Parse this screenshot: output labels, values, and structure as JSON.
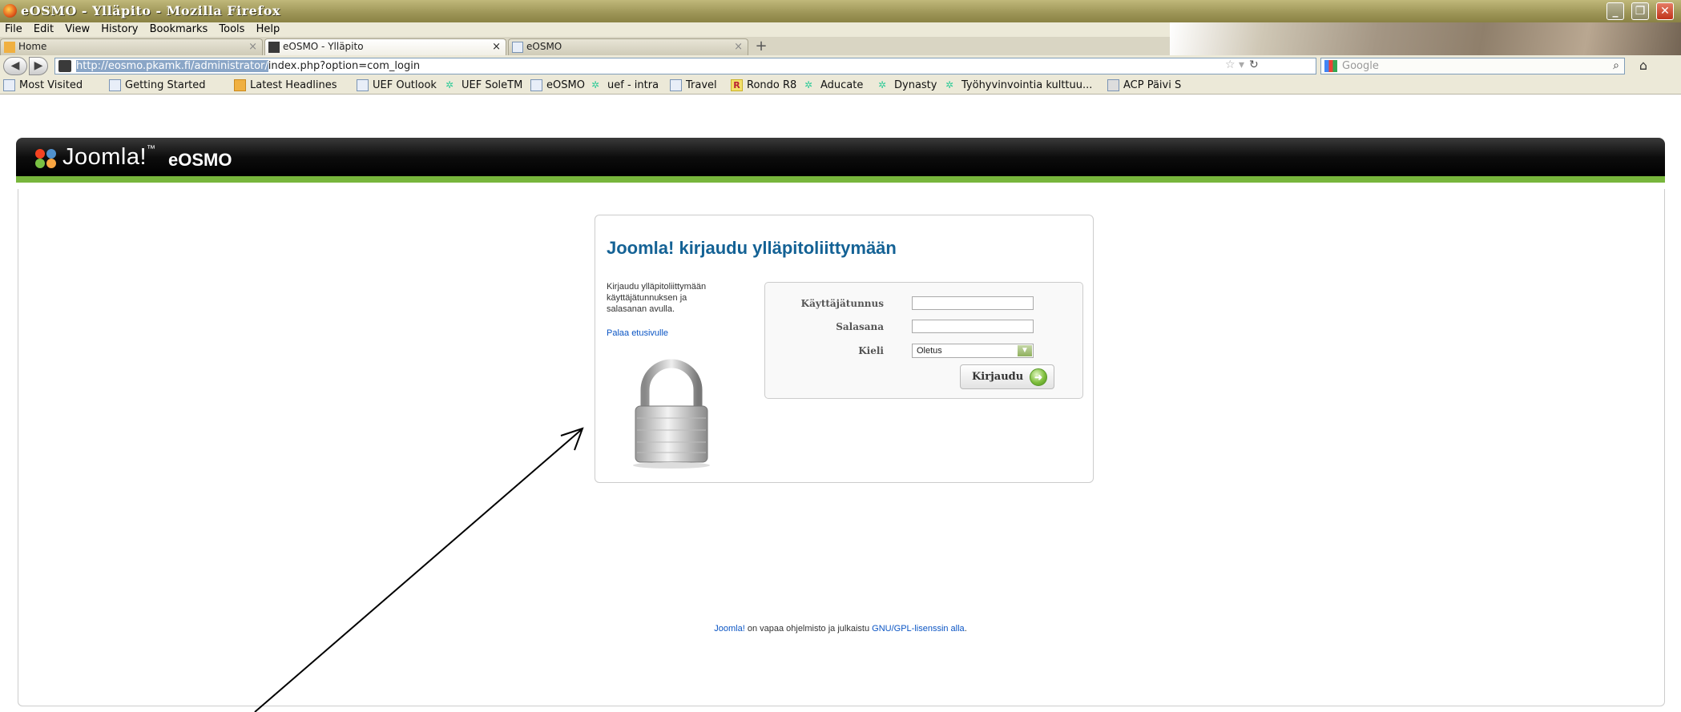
{
  "window": {
    "title": "eOSMO - Ylläpito - Mozilla Firefox"
  },
  "menu": [
    "File",
    "Edit",
    "View",
    "History",
    "Bookmarks",
    "Tools",
    "Help"
  ],
  "tabs": [
    {
      "label": "Home"
    },
    {
      "label": "eOSMO - Ylläpito"
    },
    {
      "label": "eOSMO"
    }
  ],
  "nav": {
    "url_selected": "http://eosmo.pkamk.fi/administrator/",
    "url_rest": "index.php?option=com_login",
    "search_placeholder": "Google"
  },
  "bookmarks": [
    "Most Visited",
    "Getting Started",
    "Latest Headlines",
    "UEF Outlook",
    "UEF SoleTM",
    "eOSMO",
    "uef - intra",
    "Travel",
    "Rondo R8",
    "Aducate",
    "Dynasty",
    "Työhyvinvointia kulttuu...",
    "ACP Päivi S"
  ],
  "joomla": {
    "wordmark": "Joomla!",
    "site_name": "eOSMO"
  },
  "login": {
    "title": "Joomla! kirjaudu ylläpitoliittymään",
    "description": "Kirjaudu ylläpitoliittymään käyttäjätunnuksen ja salasanan avulla.",
    "back_link": "Palaa etusivulle",
    "username_label": "Käyttäjätunnus",
    "username_value": "",
    "password_label": "Salasana",
    "password_value": "",
    "language_label": "Kieli",
    "language_value": "Oletus",
    "submit_label": "Kirjaudu"
  },
  "footer": {
    "link1": "Joomla!",
    "middle": " on vapaa ohjelmisto ja julkaistu ",
    "link2": "GNU/GPL-lisenssin alla",
    "end": "."
  }
}
